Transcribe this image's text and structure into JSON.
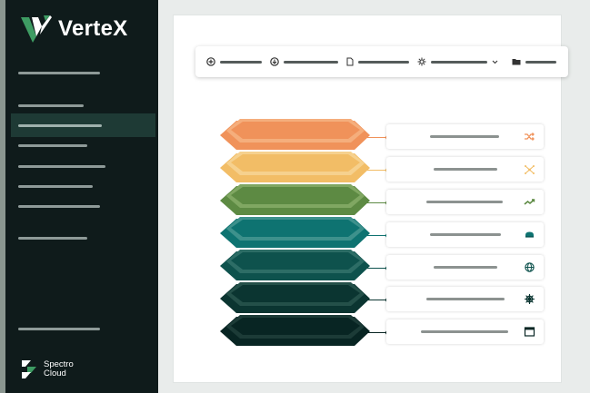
{
  "app": {
    "name": "VerteX"
  },
  "brand": {
    "line1": "Spectro",
    "line2": "Cloud"
  },
  "colors": {
    "sidebar_bg": "#0f1b1b",
    "sidebar_active": "#1e3a35",
    "accent_green": "#3e9c63",
    "layer_orange": "#f0925a",
    "layer_yellow": "#f2bd66",
    "layer_green": "#5d8a43",
    "layer_teal": "#0e7371",
    "layer_dark_teal": "#0e524d",
    "layer_darker": "#0b3531",
    "layer_darkest": "#082523"
  },
  "sidebar": {
    "items": [
      {
        "active": false
      },
      {
        "active": false
      },
      {
        "active": true
      },
      {
        "active": false
      },
      {
        "active": false
      },
      {
        "active": false
      },
      {
        "active": false
      },
      {
        "active": false
      },
      {
        "active": false
      }
    ]
  },
  "toolbar": {
    "items": [
      {
        "icon": "plus-circle-icon"
      },
      {
        "icon": "download-circle-icon"
      },
      {
        "icon": "file-icon"
      },
      {
        "icon": "settings-icon",
        "has_dropdown": true
      },
      {
        "icon": "folder-icon"
      }
    ]
  },
  "stack": {
    "layers": [
      {
        "color": "orange",
        "icon": "shuffle-icon"
      },
      {
        "color": "yellow",
        "icon": "network-icon"
      },
      {
        "color": "green",
        "icon": "trend-icon"
      },
      {
        "color": "teal",
        "icon": "storage-icon"
      },
      {
        "color": "dark-teal",
        "icon": "globe-icon"
      },
      {
        "color": "darker",
        "icon": "helm-icon"
      },
      {
        "color": "darkest",
        "icon": "browser-window-icon"
      }
    ]
  }
}
